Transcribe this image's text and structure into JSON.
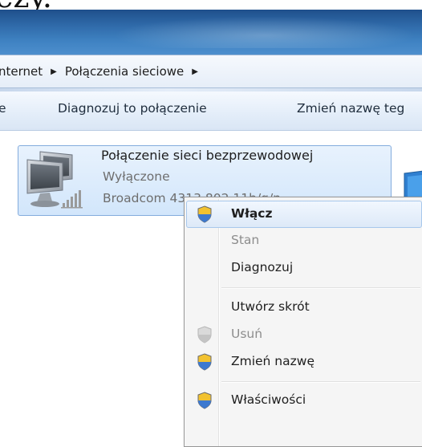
{
  "topcrop": {
    "text": "ezy."
  },
  "breadcrumb": {
    "items": [
      "nternet",
      "Połączenia sieciowe"
    ],
    "separator": "▶"
  },
  "toolbar": {
    "items": [
      "e",
      "Diagnozuj to połączenie",
      "Zmień nazwę teg"
    ]
  },
  "connection": {
    "name": "Połączenie sieci bezprzewodowej",
    "status": "Wyłączone",
    "device": "Broadcom 4313 802.11b/g/n"
  },
  "context_menu": {
    "items": [
      {
        "label": "Włącz",
        "bold": true,
        "disabled": false,
        "icon": "uac-shield-icon",
        "highlighted": true
      },
      {
        "label": "Stan",
        "bold": false,
        "disabled": true,
        "icon": ""
      },
      {
        "label": "Diagnozuj",
        "bold": false,
        "disabled": false,
        "icon": ""
      },
      {
        "label": "Utwórz skrót",
        "bold": false,
        "disabled": false,
        "icon": ""
      },
      {
        "label": "Usuń",
        "bold": false,
        "disabled": true,
        "icon": "uac-shield-disabled-icon"
      },
      {
        "label": "Zmień nazwę",
        "bold": false,
        "disabled": false,
        "icon": "uac-shield-icon"
      },
      {
        "label": "Właściwości",
        "bold": false,
        "disabled": false,
        "icon": "uac-shield-icon"
      }
    ]
  },
  "colors": {
    "titlebar": "#2f6aa9",
    "selection": "#d2e6fb",
    "disabled_text": "#8d8d8d",
    "error_x": "#d3262b"
  }
}
